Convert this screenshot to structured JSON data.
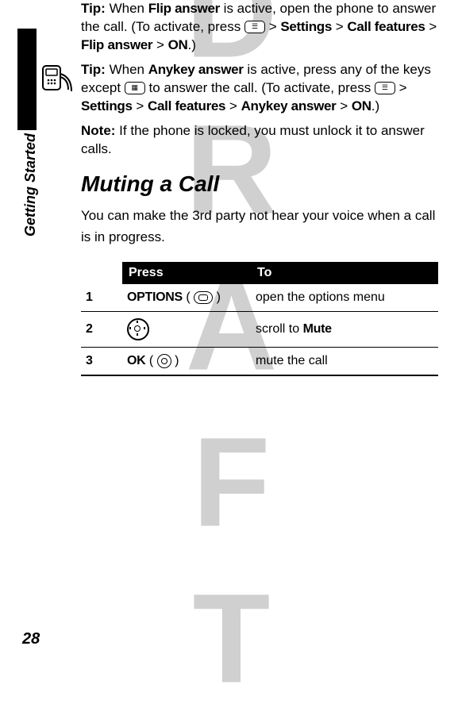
{
  "watermark": "DRAFT",
  "sideLabel": "Getting Started",
  "pageNumber": "28",
  "tip1": {
    "lead": "Tip:",
    "t1": " When ",
    "b1": "Flip answer",
    "t2": " is active, open the phone to answer the call. (To activate, press ",
    "t3": " > ",
    "b2": "Settings",
    "t4": " > ",
    "b3": "Call features",
    "t5": " > ",
    "b4": "Flip answer",
    "t6": " > ",
    "b5": "ON",
    "t7": ".)"
  },
  "tip2": {
    "lead": "Tip:",
    "t1": " When ",
    "b1": "Anykey answer",
    "t2": " is active, press any of the keys except ",
    "t3": " to answer the call. (To activate, press ",
    "t4": " > ",
    "b2": "Settings",
    "t5": " > ",
    "b3": "Call features",
    "t6": " > ",
    "b4": "Anykey answer",
    "t7": " > ",
    "b5": "ON",
    "t8": ".)"
  },
  "note": {
    "lead": "Note:",
    "text": " If the phone is locked, you must unlock it to answer calls."
  },
  "heading": "Muting a Call",
  "intro": "You can make the 3rd party not hear your voice when a call is in progress.",
  "table": {
    "hPress": "Press",
    "hTo": "To",
    "rows": [
      {
        "n": "1",
        "pressLabel": "OPTIONS",
        "keyType": "softkey",
        "to": "open the options menu"
      },
      {
        "n": "2",
        "pressLabel": "",
        "keyType": "navkey",
        "to_a": "scroll to ",
        "to_b": "Mute"
      },
      {
        "n": "3",
        "pressLabel": "OK",
        "keyType": "centerkey",
        "to": "mute the call"
      }
    ]
  }
}
